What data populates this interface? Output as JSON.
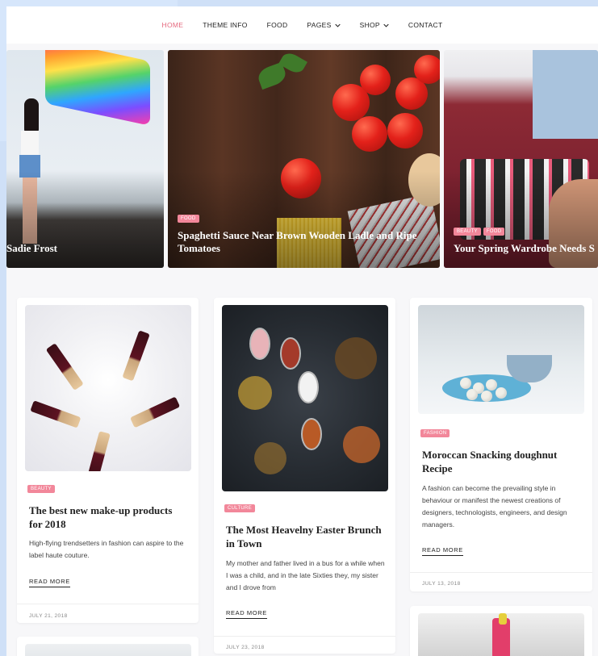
{
  "nav": {
    "items": [
      {
        "label": "HOME",
        "active": true,
        "dropdown": false
      },
      {
        "label": "THEME INFO",
        "active": false,
        "dropdown": false
      },
      {
        "label": "FOOD",
        "active": false,
        "dropdown": false
      },
      {
        "label": "PAGES",
        "active": false,
        "dropdown": true
      },
      {
        "label": "SHOP",
        "active": false,
        "dropdown": true
      },
      {
        "label": "CONTACT",
        "active": false,
        "dropdown": false
      }
    ]
  },
  "slider": {
    "slides": [
      {
        "categories": [],
        "title": "Sadie Frost"
      },
      {
        "categories": [
          "FOOD"
        ],
        "title": "Spaghetti Sauce Near Brown Wooden Ladle and Ripe Tomatoes"
      },
      {
        "categories": [
          "BEAUTY",
          "FOOD"
        ],
        "title": "Your Spring Wardrobe Needs S"
      }
    ]
  },
  "posts": [
    {
      "category": "BEAUTY",
      "title": "The best new make-up products for 2018",
      "excerpt": "High-flying trendsetters in fashion can aspire to the label haute couture.",
      "read_more": "READ MORE",
      "date": "JULY 21, 2018"
    },
    {
      "category": "CULTURE",
      "title": "The Most Heavelny Easter Brunch in Town",
      "excerpt": "My mother and father lived in a bus for a while when I was a child, and in the late Sixties they, my sister and I drove from",
      "read_more": "READ MORE",
      "date": "JULY 23, 2018"
    },
    {
      "category": "FASHION",
      "title": "Moroccan Snacking doughnut Recipe",
      "excerpt": "A fashion can become the prevailing style in behaviour or manifest the newest creations of designers, technologists, engineers, and design managers.",
      "read_more": "READ MORE",
      "date": "JULY 13, 2018"
    }
  ],
  "colors": {
    "accent": "#e56a7f",
    "badge": "#f2879a",
    "page_bg": "#f7f7f9",
    "outer_bg": "#cfe0f7"
  }
}
